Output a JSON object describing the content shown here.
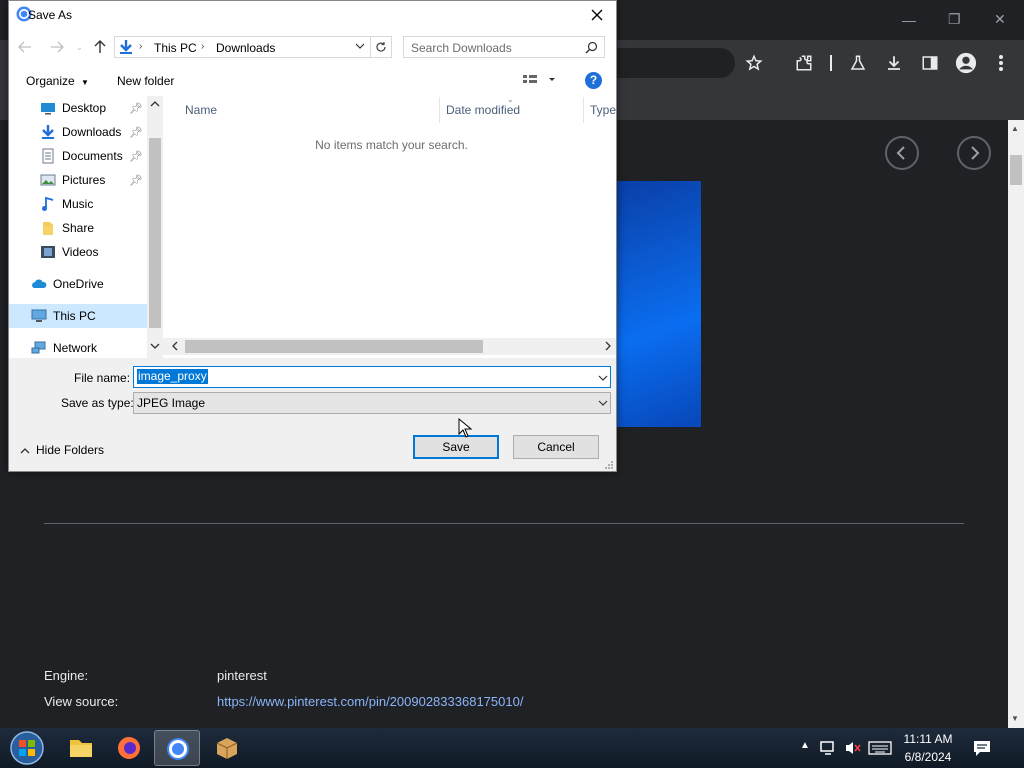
{
  "browser": {
    "window_controls": {
      "minimize": "—",
      "restore": "❐",
      "close": "✕"
    },
    "page": {
      "engine_label": "Engine:",
      "engine_value": "pinterest",
      "view_source_label": "View source:",
      "view_source_link": "https://www.pinterest.com/pin/200902833368175010/"
    }
  },
  "dialog": {
    "title": "Save As",
    "breadcrumb": [
      "This PC",
      "Downloads"
    ],
    "search_placeholder": "Search Downloads",
    "organize_label": "Organize",
    "new_folder_label": "New folder",
    "help_label": "?",
    "nav_items": [
      {
        "label": "Desktop",
        "icon": "desktop-icon",
        "pinned": true
      },
      {
        "label": "Downloads",
        "icon": "downloads-icon",
        "pinned": true
      },
      {
        "label": "Documents",
        "icon": "documents-icon",
        "pinned": true
      },
      {
        "label": "Pictures",
        "icon": "pictures-icon",
        "pinned": true
      },
      {
        "label": "Music",
        "icon": "music-icon",
        "pinned": false
      },
      {
        "label": "Share",
        "icon": "folder-icon",
        "pinned": false
      },
      {
        "label": "Videos",
        "icon": "videos-icon",
        "pinned": false
      },
      {
        "label": "OneDrive",
        "icon": "onedrive-icon",
        "pinned": false
      },
      {
        "label": "This PC",
        "icon": "this-pc-icon",
        "pinned": false,
        "selected": true
      },
      {
        "label": "Network",
        "icon": "network-icon",
        "pinned": false
      }
    ],
    "columns": [
      "Name",
      "Date modified",
      "Type"
    ],
    "empty_message": "No items match your search.",
    "file_name_label": "File name:",
    "file_name_value": "image_proxy",
    "save_type_label": "Save as type:",
    "save_type_value": "JPEG Image",
    "hide_folders_label": "Hide Folders",
    "save_label": "Save",
    "cancel_label": "Cancel"
  },
  "taskbar": {
    "time": "11:11 AM",
    "date": "6/8/2024"
  },
  "colors": {
    "accent": "#0078d7",
    "browser_bg": "#202124",
    "link": "#8ab4f8"
  }
}
